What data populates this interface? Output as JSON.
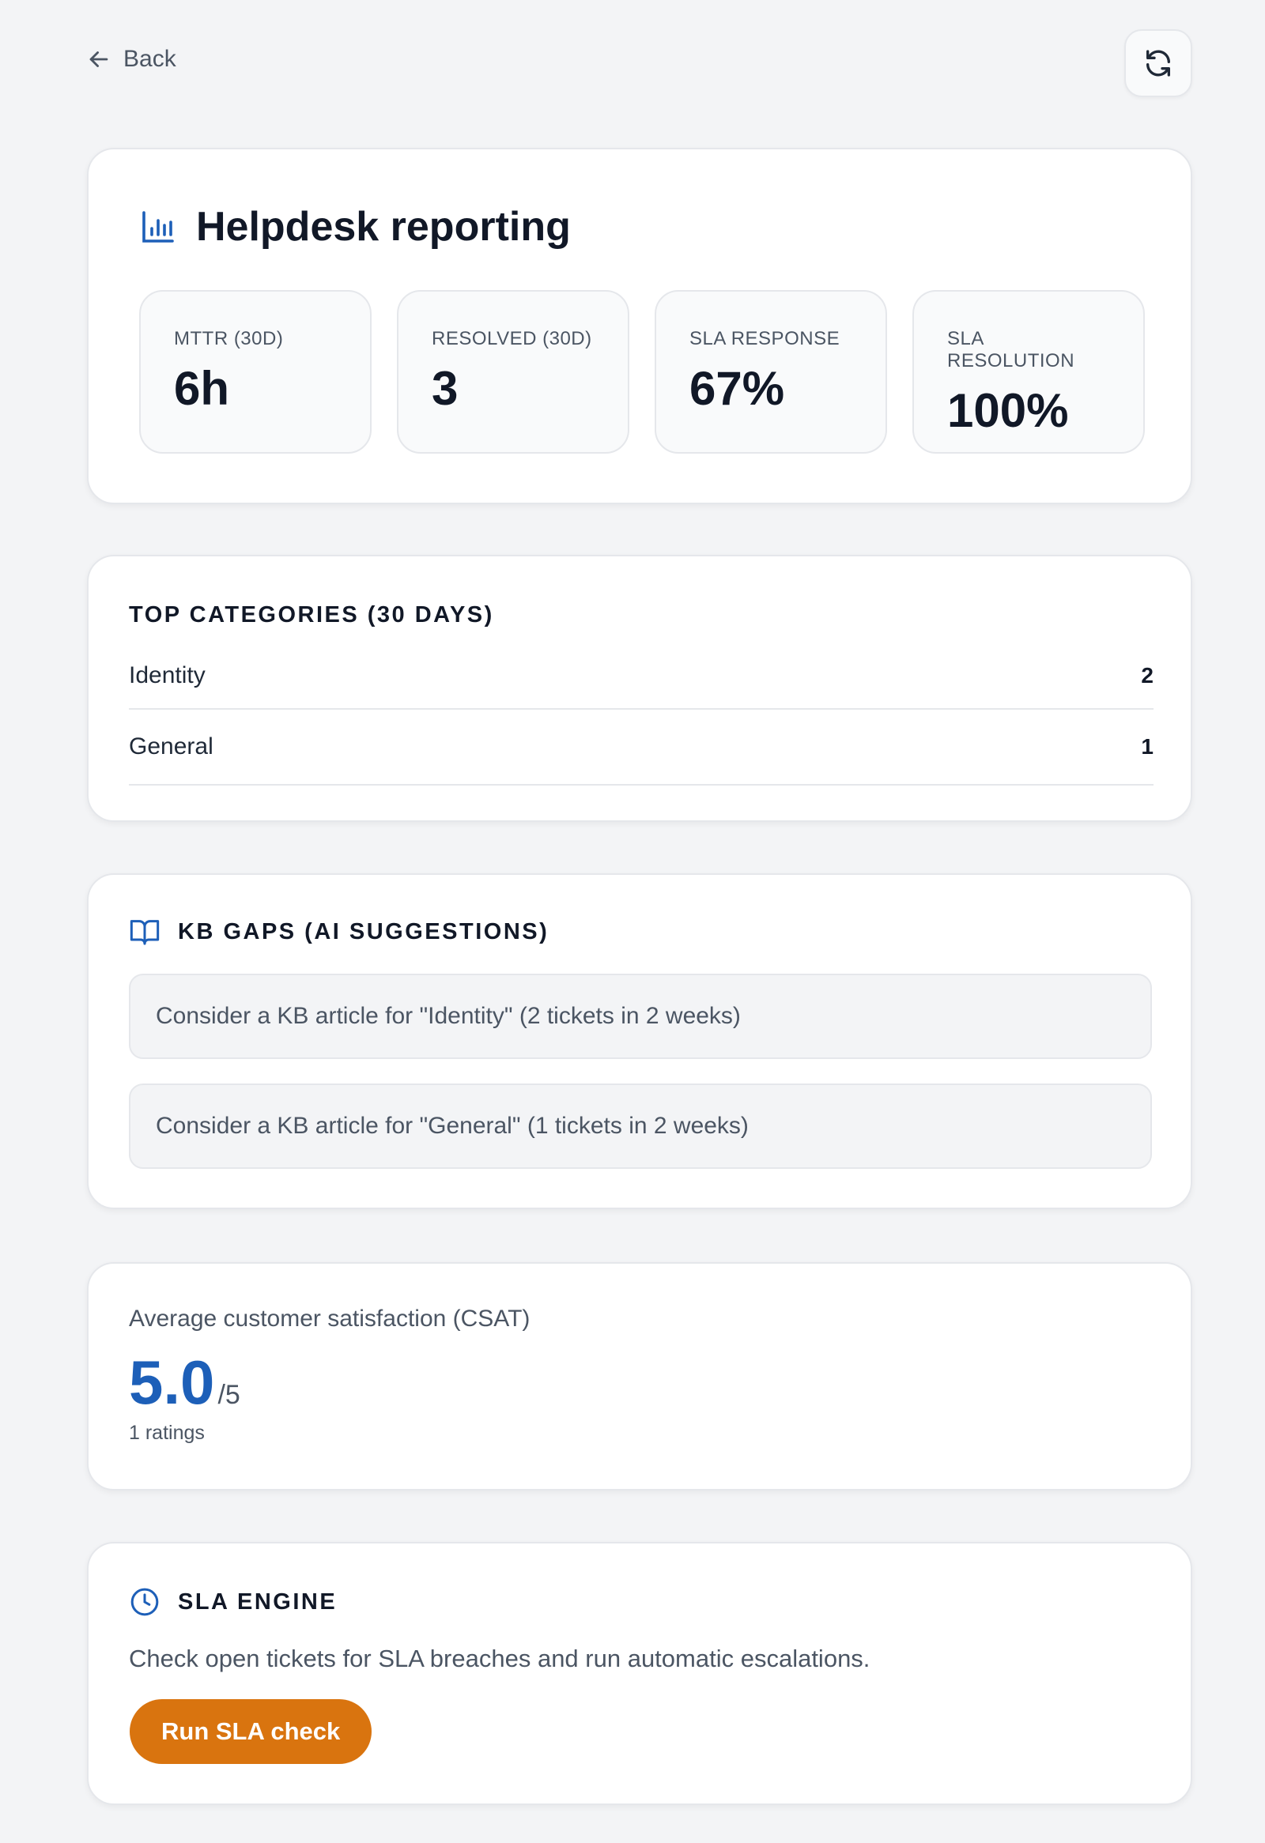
{
  "nav": {
    "back_label": "Back",
    "refresh_icon": "refresh-icon"
  },
  "report": {
    "title": "Helpdesk reporting",
    "icon": "bar-chart-icon",
    "stats": [
      {
        "label": "MTTR (30D)",
        "value": "6h"
      },
      {
        "label": "RESOLVED (30D)",
        "value": "3"
      },
      {
        "label": "SLA RESPONSE",
        "value": "67%"
      },
      {
        "label": "SLA RESOLUTION",
        "value": "100%"
      }
    ]
  },
  "categories": {
    "heading": "TOP CATEGORIES (30 DAYS)",
    "items": [
      {
        "name": "Identity",
        "count": "2"
      },
      {
        "name": "General",
        "count": "1"
      }
    ]
  },
  "kb_gaps": {
    "heading": "KB GAPS (AI SUGGESTIONS)",
    "icon": "book-open-icon",
    "suggestions": [
      "Consider a KB article for \"Identity\" (2 tickets in 2 weeks)",
      "Consider a KB article for \"General\" (1 tickets in 2 weeks)"
    ]
  },
  "csat": {
    "label": "Average customer satisfaction (CSAT)",
    "score": "5.0",
    "scale": "/5",
    "ratings": "1 ratings"
  },
  "sla_engine": {
    "heading": "SLA ENGINE",
    "icon": "clock-icon",
    "description": "Check open tickets for SLA breaches and run automatic escalations.",
    "button_label": "Run SLA check"
  },
  "colors": {
    "accent_blue": "#1d5fb8",
    "button_orange": "#d9740f",
    "background": "#f3f4f6"
  }
}
